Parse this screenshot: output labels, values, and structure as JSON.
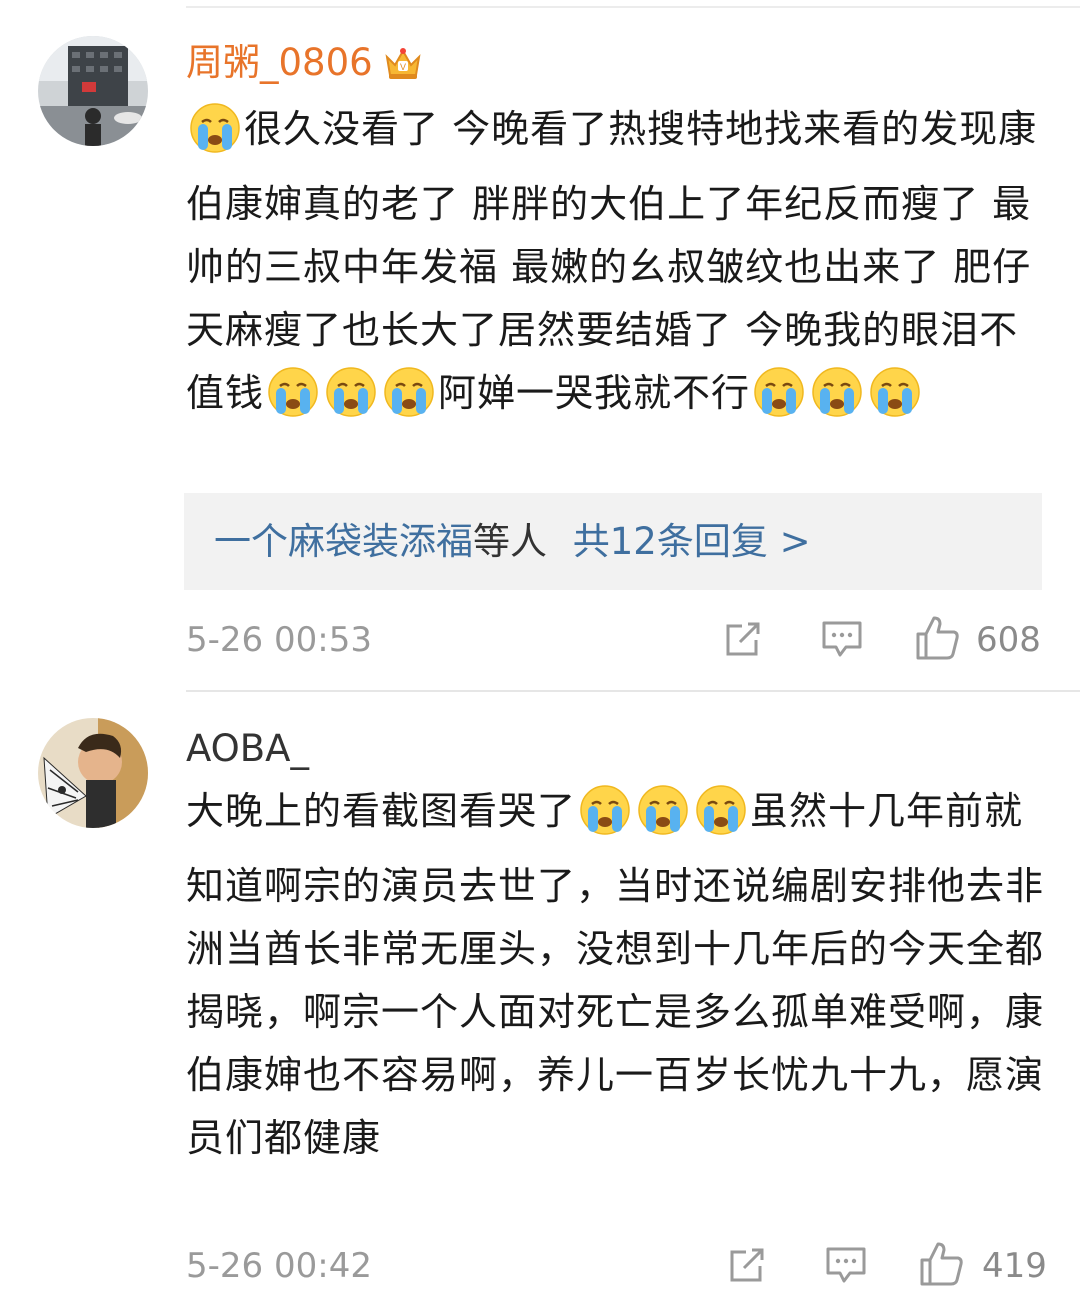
{
  "comments": [
    {
      "username": "周粥_0806",
      "username_color": "#e8742a",
      "has_crown_badge": true,
      "text_segments": [
        {
          "type": "emoji",
          "name": "crying-face"
        },
        {
          "type": "text",
          "value": "很久没看了 今晚看了热搜特地找来看的发现康伯康婶真的老了 胖胖的大伯上了年纪反而瘦了 最帅的三叔中年发福 最嫩的幺叔皱纹也出来了 肥仔天麻瘦了也长大了居然要结婚了 今晚我的眼泪不值钱"
        },
        {
          "type": "emoji",
          "name": "crying-face"
        },
        {
          "type": "emoji",
          "name": "crying-face"
        },
        {
          "type": "emoji",
          "name": "crying-face"
        },
        {
          "type": "text",
          "value": "阿婵一哭我就不行"
        },
        {
          "type": "emoji",
          "name": "crying-face"
        },
        {
          "type": "emoji",
          "name": "crying-face"
        },
        {
          "type": "emoji",
          "name": "crying-face"
        }
      ],
      "replies": {
        "link_name": "一个麻袋装添福",
        "suffix": "等人",
        "count_text": "共12条回复 >"
      },
      "time": "5-26 00:53",
      "likes": "608"
    },
    {
      "username": "AOBA_",
      "username_color": "#333333",
      "has_crown_badge": false,
      "text_segments": [
        {
          "type": "text",
          "value": "大晚上的看截图看哭了"
        },
        {
          "type": "emoji",
          "name": "crying-face"
        },
        {
          "type": "emoji",
          "name": "crying-face"
        },
        {
          "type": "emoji",
          "name": "crying-face"
        },
        {
          "type": "text",
          "value": "虽然十几年前就知道啊宗的演员去世了，当时还说编剧安排他去非洲当酋长非常无厘头，没想到十几年后的今天全都揭晓，啊宗一个人面对死亡是多么孤单难受啊，康伯康婶也不容易啊，养儿一百岁长忧九十九，愿演员们都健康"
        }
      ],
      "time": "5-26 00:42",
      "likes": "419"
    }
  ],
  "icons": [
    "crown-badge-icon",
    "crying-face-emoji",
    "repost-icon",
    "comment-icon",
    "like-thumb-icon"
  ]
}
